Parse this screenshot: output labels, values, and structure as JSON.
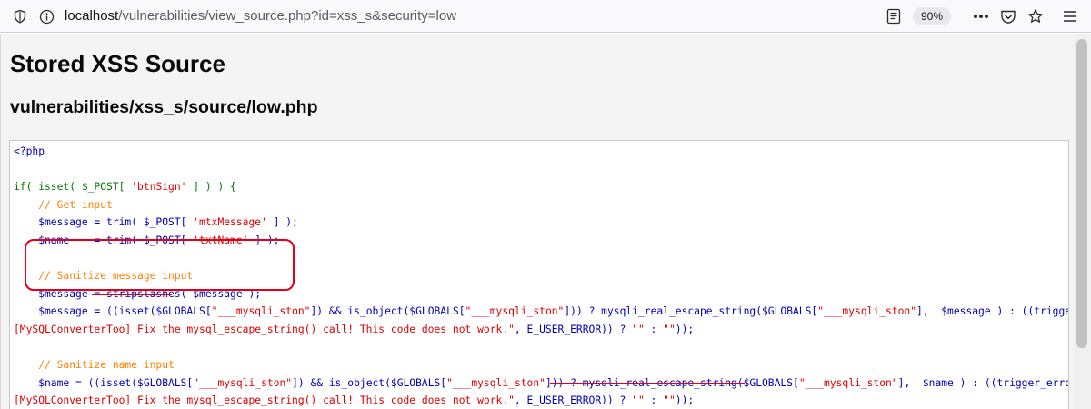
{
  "browser": {
    "url_host": "localhost",
    "url_path": "/vulnerabilities/view_source.php?id=xss_s&security=low",
    "zoom": "90%",
    "icons": [
      "shield-icon",
      "info-icon",
      "reader-mode-icon",
      "more-icon",
      "pocket-icon",
      "star-icon",
      "menu-icon"
    ]
  },
  "page": {
    "title": "Stored XSS Source",
    "file_path": "vulnerabilities/xss_s/source/low.php"
  },
  "code": {
    "lines": [
      [
        {
          "t": "<?php",
          "c": "def"
        }
      ],
      [],
      [
        {
          "t": "if( isset( $_POST[ ",
          "c": "kw"
        },
        {
          "t": "'btnSign'",
          "c": "str"
        },
        {
          "t": " ] ) ) {",
          "c": "kw"
        }
      ],
      [
        {
          "t": "    // Get input",
          "c": "cm"
        }
      ],
      [
        {
          "t": "    $message = trim( $_POST[ ",
          "c": "var"
        },
        {
          "t": "'mtxMessage'",
          "c": "str"
        },
        {
          "t": " ] );",
          "c": "var"
        }
      ],
      [
        {
          "t": "    $name    = trim( $_POST[ ",
          "c": "var"
        },
        {
          "t": "'txtName'",
          "c": "str"
        },
        {
          "t": " ] );",
          "c": "var"
        }
      ],
      [],
      [
        {
          "t": "    // Sanitize message input",
          "c": "cm"
        }
      ],
      [
        {
          "t": "    $message = stripslashes( $message );",
          "c": "var"
        }
      ],
      [
        {
          "t": "    $message = ((isset($GLOBALS[",
          "c": "var"
        },
        {
          "t": "\"___mysqli_ston\"",
          "c": "str"
        },
        {
          "t": "]) && is_object($GLOBALS[",
          "c": "var"
        },
        {
          "t": "\"___mysqli_ston\"",
          "c": "str"
        },
        {
          "t": "])) ? mysqli_real_escape_string($GLOBALS[",
          "c": "var"
        },
        {
          "t": "\"___mysqli_ston\"",
          "c": "str"
        },
        {
          "t": "],  $message ) : ((trigger_error(",
          "c": "var"
        },
        {
          "t": "\"",
          "c": "str"
        }
      ],
      [
        {
          "t": "[MySQLConverterToo] Fix the mysql_escape_string() call! This code does not work.\"",
          "c": "str"
        },
        {
          "t": ", E_USER_ERROR)) ? ",
          "c": "var"
        },
        {
          "t": "\"\"",
          "c": "str"
        },
        {
          "t": " : ",
          "c": "var"
        },
        {
          "t": "\"\"",
          "c": "str"
        },
        {
          "t": "));",
          "c": "var"
        }
      ],
      [],
      [
        {
          "t": "    // Sanitize name input",
          "c": "cm"
        }
      ],
      [
        {
          "t": "    $name = ((isset($GLOBALS[",
          "c": "var"
        },
        {
          "t": "\"___mysqli_ston\"",
          "c": "str"
        },
        {
          "t": "]) && is_object($GLOBALS[",
          "c": "var"
        },
        {
          "t": "\"___mysqli_ston\"",
          "c": "str"
        },
        {
          "t": "])) ? mysqli_real_escape_string($GLOBALS[",
          "c": "var"
        },
        {
          "t": "\"___mysqli_ston\"",
          "c": "str"
        },
        {
          "t": "],  $name ) : ((trigger_error(",
          "c": "var"
        },
        {
          "t": "\"",
          "c": "str"
        }
      ],
      [
        {
          "t": "[MySQLConverterToo] Fix the mysql_escape_string() call! This code does not work.\"",
          "c": "str"
        },
        {
          "t": ", E_USER_ERROR)) ? ",
          "c": "var"
        },
        {
          "t": "\"\"",
          "c": "str"
        },
        {
          "t": " : ",
          "c": "var"
        },
        {
          "t": "\"\"",
          "c": "str"
        },
        {
          "t": "));",
          "c": "var"
        }
      ]
    ]
  },
  "colors": {
    "keyword": "#007700",
    "string": "#dd0000",
    "comment": "#ff8000",
    "default": "#0000bb",
    "annotation": "#e2001a"
  }
}
